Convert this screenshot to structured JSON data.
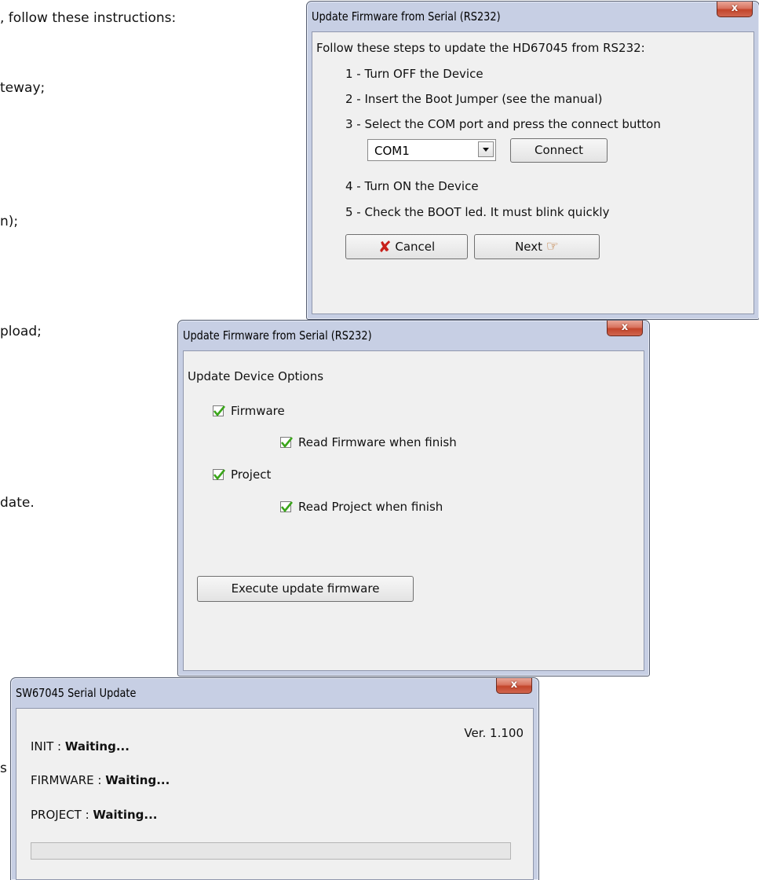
{
  "background": {
    "lines": [
      ", follow these instructions:",
      "teway;",
      "n);",
      "pload;",
      "date.",
      "s"
    ]
  },
  "window1": {
    "title": "Update Firmware from Serial (RS232)",
    "close_label": "x",
    "intro": "Follow these steps to update the HD67045 from RS232:",
    "steps": [
      "1 - Turn OFF the Device",
      "2 - Insert the Boot Jumper (see the manual)",
      "3 - Select the  COM port and press the connect button",
      "4 - Turn ON the Device",
      "5 - Check the BOOT led. It must blink quickly"
    ],
    "com_port": "COM1",
    "connect_label": "Connect",
    "cancel_label": "Cancel",
    "next_label": "Next"
  },
  "window2": {
    "title": "Update Firmware from Serial (RS232)",
    "close_label": "x",
    "heading": "Update Device Options",
    "options": [
      {
        "label": "Firmware",
        "checked": true
      },
      {
        "label": "Read Firmware when finish",
        "checked": true
      },
      {
        "label": "Project",
        "checked": true
      },
      {
        "label": "Read Project when finish",
        "checked": true
      }
    ],
    "execute_label": "Execute update firmware"
  },
  "window3": {
    "title": "SW67045 Serial Update",
    "close_label": "x",
    "version": "Ver. 1.100",
    "rows": [
      {
        "label": "INIT : ",
        "value": "Waiting..."
      },
      {
        "label": "FIRMWARE : ",
        "value": "Waiting..."
      },
      {
        "label": "PROJECT : ",
        "value": "Waiting..."
      }
    ],
    "progress": 0
  },
  "colors": {
    "frame": "#c7cfe4",
    "client": "#f0f0f0",
    "close_red": "#c2452b",
    "check_green": "#3aa51a",
    "cancel_red": "#c8201a"
  }
}
